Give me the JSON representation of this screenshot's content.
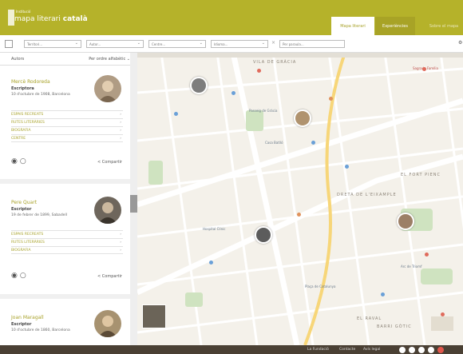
{
  "header": {
    "logo_sup": "Institució",
    "title_regular": "mapa literari",
    "title_bold": "català",
    "tabs": [
      {
        "label": "Mapa literari"
      },
      {
        "label": "Experiències"
      },
      {
        "label": "Sobre el mapa"
      }
    ]
  },
  "filters": [
    {
      "placeholder": "Territori..."
    },
    {
      "placeholder": "Autor..."
    },
    {
      "placeholder": "Centre..."
    },
    {
      "placeholder": "Idioma..."
    },
    {
      "placeholder": "Per paraula..."
    }
  ],
  "sidebar": {
    "heading": "Autors",
    "sort_label": "Per ordre alfabètic",
    "cards": [
      {
        "name": "Mercè Rodoreda",
        "role": "Escriptora",
        "date": "10 d'octubre de 1908, Barcelona",
        "rows": [
          "ESPAIS RECREATS",
          "RUTES LITERÀRIES",
          "BIOGRAFIA",
          "CENTRE"
        ],
        "share": "Compartir"
      },
      {
        "name": "Pere Quart",
        "role": "Escriptor",
        "date": "19 de febrer de 1899, Sabadell",
        "rows": [
          "ESPAIS RECREATS",
          "RUTES LITERÀRIES",
          "BIOGRAFIA"
        ],
        "share": "Compartir"
      },
      {
        "name": "Joan Maragall",
        "role": "Escriptor",
        "date": "10 d'octubre de 1860, Barcelona"
      }
    ]
  },
  "map": {
    "labels": [
      {
        "text": "VILA DE GRÀCIA"
      },
      {
        "text": "EL FORT PIENC"
      },
      {
        "text": "DRETA DE L'EIXAMPLE"
      },
      {
        "text": "Passeig de Gràcia"
      },
      {
        "text": "Casa Batlló"
      },
      {
        "text": "Sagrada Família"
      },
      {
        "text": "Hospital Clínic"
      },
      {
        "text": "Plaça de Catalunya"
      },
      {
        "text": "Arc de Triomf"
      },
      {
        "text": "EL RAVAL"
      },
      {
        "text": "BARRI GÒTIC"
      }
    ]
  },
  "footer": {
    "links": [
      "La Fundació",
      "Contacte",
      "Avís legal"
    ]
  }
}
